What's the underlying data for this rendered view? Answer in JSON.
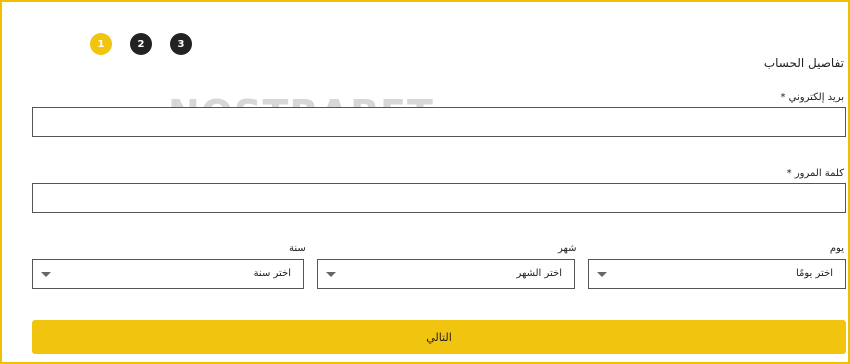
{
  "steps": [
    "1",
    "2",
    "3"
  ],
  "section_title": "تفاصيل الحساب",
  "watermark": "NOSTRABET",
  "email": {
    "label": "بريد إلكتروني *",
    "value": ""
  },
  "password": {
    "label": "كلمة المرور *",
    "value": ""
  },
  "birthdate": {
    "day": {
      "label": "يوم",
      "value": "اختر يومًا"
    },
    "month": {
      "label": "شهر",
      "value": "اختر الشهر"
    },
    "year": {
      "label": "سنة",
      "value": "اختر سنة"
    }
  },
  "next_label": "التالي",
  "colors": {
    "accent": "#f1c40f",
    "border": "#f0c000"
  }
}
